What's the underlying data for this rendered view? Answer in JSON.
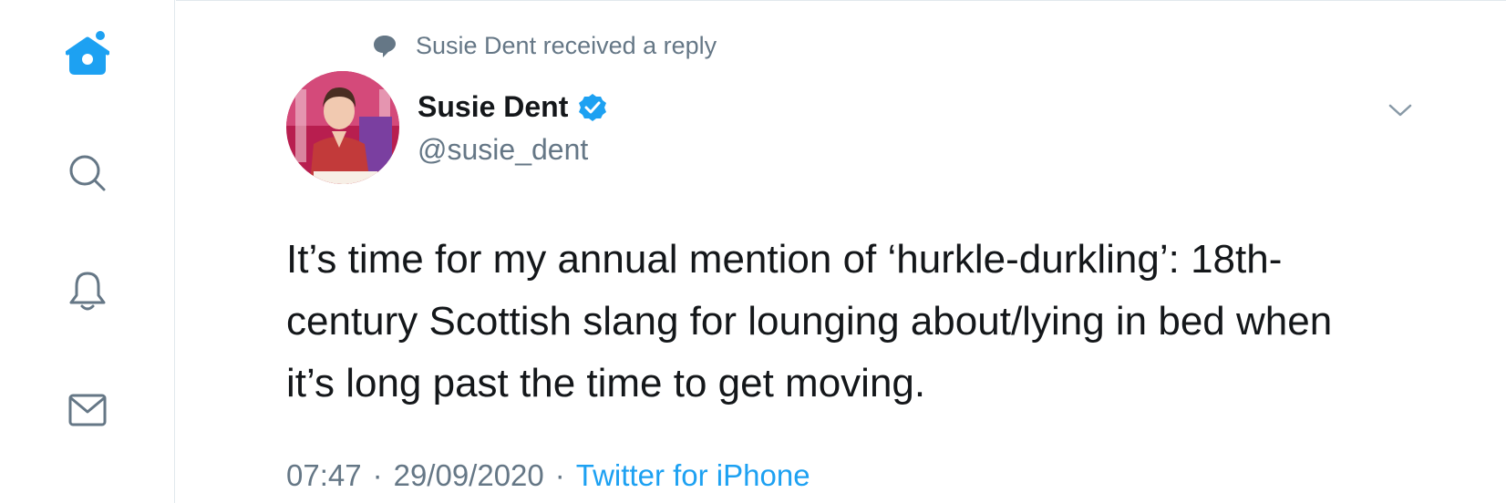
{
  "nav": {
    "items": [
      {
        "icon": "home-icon"
      },
      {
        "icon": "search-icon"
      },
      {
        "icon": "bell-icon"
      },
      {
        "icon": "mail-icon"
      }
    ]
  },
  "context": {
    "icon": "speech-bubble-icon",
    "text": "Susie Dent received a reply"
  },
  "tweet": {
    "author_name": "Susie Dent",
    "verified": true,
    "handle": "@susie_dent",
    "text": "It’s time for my annual mention of ‘hurkle-durkling’: 18th-century Scottish slang for lounging about/lying in bed when it’s long past the time to get moving.",
    "time": "07:47",
    "date": "29/09/2020",
    "separator": "·",
    "source": "Twitter for iPhone"
  },
  "colors": {
    "accent": "#1da1f2",
    "icon_gray": "#657786",
    "text": "#14171a",
    "border": "#e1e8ed"
  }
}
